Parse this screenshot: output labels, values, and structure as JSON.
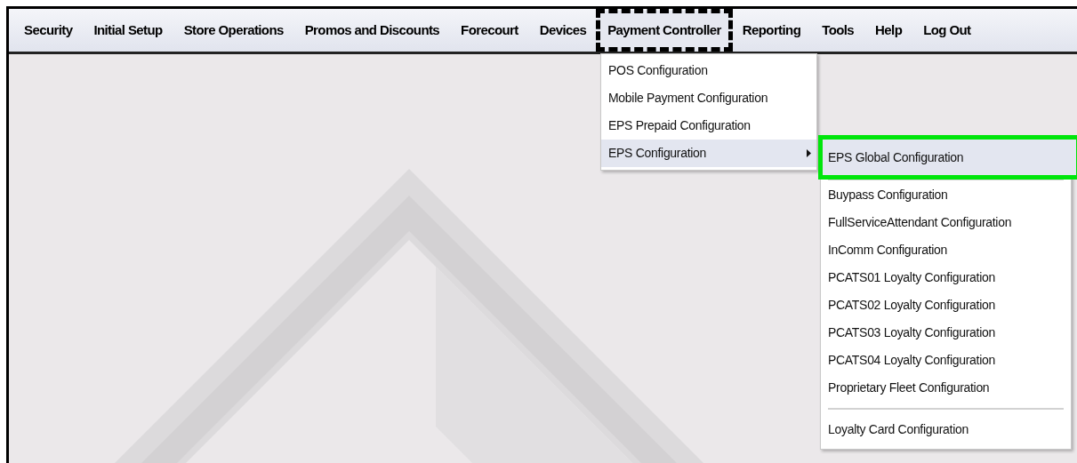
{
  "menu_bar": {
    "items": [
      {
        "label": "Security",
        "selected": false
      },
      {
        "label": "Initial Setup",
        "selected": false
      },
      {
        "label": "Store Operations",
        "selected": false
      },
      {
        "label": "Promos and Discounts",
        "selected": false
      },
      {
        "label": "Forecourt",
        "selected": false
      },
      {
        "label": "Devices",
        "selected": false
      },
      {
        "label": "Payment Controller",
        "selected": true
      },
      {
        "label": "Reporting",
        "selected": false
      },
      {
        "label": "Tools",
        "selected": false
      },
      {
        "label": "Help",
        "selected": false
      },
      {
        "label": "Log Out",
        "selected": false
      }
    ]
  },
  "dropdown": {
    "items": [
      {
        "label": "POS Configuration",
        "kind": "item",
        "selected": false
      },
      {
        "label": "Mobile Payment Configuration",
        "kind": "item",
        "selected": false
      },
      {
        "label": "EPS Prepaid Configuration",
        "kind": "item",
        "selected": false
      },
      {
        "label": "EPS Configuration",
        "kind": "submenu",
        "selected": true
      }
    ]
  },
  "submenu": {
    "groups": [
      [
        {
          "label": "EPS Global Configuration",
          "selected": true
        }
      ],
      [
        {
          "label": "Buypass Configuration",
          "selected": false
        },
        {
          "label": "FullServiceAttendant Configuration",
          "selected": false
        },
        {
          "label": "InComm Configuration",
          "selected": false
        },
        {
          "label": "PCATS01 Loyalty Configuration",
          "selected": false
        },
        {
          "label": "PCATS02 Loyalty Configuration",
          "selected": false
        },
        {
          "label": "PCATS03 Loyalty Configuration",
          "selected": false
        },
        {
          "label": "PCATS04 Loyalty Configuration",
          "selected": false
        },
        {
          "label": "Proprietary Fleet Configuration",
          "selected": false
        }
      ],
      [
        {
          "label": "Loyalty Card Configuration",
          "selected": false
        }
      ]
    ]
  }
}
